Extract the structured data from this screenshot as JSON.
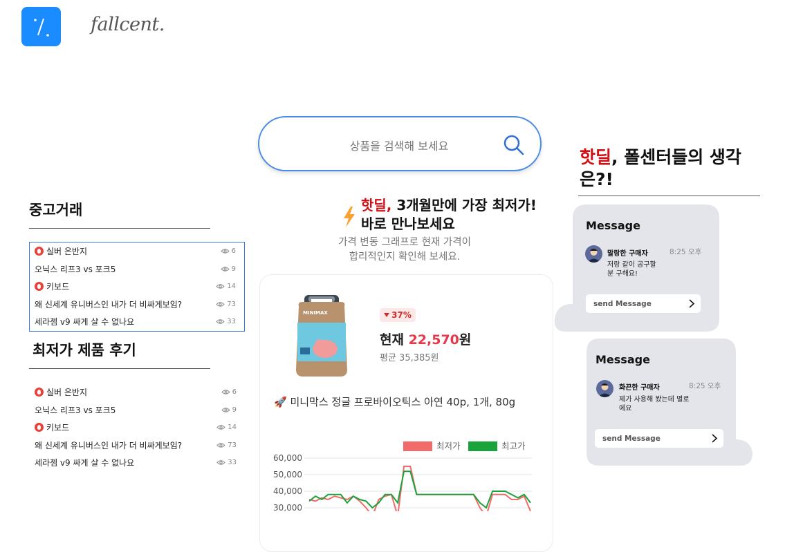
{
  "brand": {
    "name": "fallcent."
  },
  "search": {
    "placeholder": "상품을 검색해 보세요"
  },
  "used_trade": {
    "title": "중고거래",
    "items": [
      {
        "label": "실버 은반지",
        "hot": true,
        "views": "6"
      },
      {
        "label": "오닉스 리프3 vs 포크5",
        "hot": false,
        "views": "9"
      },
      {
        "label": "키보드",
        "hot": true,
        "views": "14"
      },
      {
        "label": "왜 신세계 유니버스인 내가 더 비싸게보임?",
        "hot": false,
        "views": "73"
      },
      {
        "label": "세라젬 v9 싸게 살 수 없나요",
        "hot": false,
        "views": "33"
      }
    ]
  },
  "reviews": {
    "title": "최저가 제품 후기",
    "items": [
      {
        "label": "실버 은반지",
        "hot": true,
        "views": "6"
      },
      {
        "label": "오닉스 리프3 vs 포크5",
        "hot": false,
        "views": "9"
      },
      {
        "label": "키보드",
        "hot": true,
        "views": "14"
      },
      {
        "label": "왜 신세계 유니버스인 내가 더 비싸게보임?",
        "hot": false,
        "views": "73"
      },
      {
        "label": "세라젬 v9 싸게 살 수 없나요",
        "hot": false,
        "views": "33"
      }
    ]
  },
  "deal": {
    "highlight": "핫딜,",
    "headline_1": " 3개월만에 가장 최저가!",
    "headline_2": "바로 만나보세요",
    "sub_1": "가격 변동 그래프로 현재 가격이",
    "sub_2": "합리적인지 확인해 보세요.",
    "discount": "37%",
    "current_label": "현재 ",
    "current_price": "22,570",
    "currency": "원",
    "average": "평균 35,385원",
    "product_name": "🚀 미니막스 정글 프로바이오틱스 아연 40p, 1개, 80g"
  },
  "community": {
    "highlight": "핫딜",
    "title_rest": ", 폴센터들의 생각은?!"
  },
  "messages": [
    {
      "title": "Message",
      "user": "말랑한 구매자",
      "time": "8:25 오후",
      "text": "저랑 같이 공구할 분 구해요!",
      "send": "send Message"
    },
    {
      "title": "Message",
      "user": "화끈한 구매자",
      "time": "8:25 오후",
      "text": "제가 사용해 봤는데 별로에요",
      "send": "send Message"
    }
  ],
  "colors": {
    "accent": "#1a8cff",
    "deal_red": "#d10f14",
    "low_series": "#f26b6b",
    "high_series": "#1aa33a"
  },
  "chart_data": {
    "type": "line",
    "legend": [
      "최저가",
      "최고가"
    ],
    "yticks": [
      "60,000",
      "50,000",
      "40,000",
      "30,000"
    ],
    "ylim": [
      25000,
      65000
    ],
    "series": [
      {
        "name": "최저가",
        "values": [
          35000,
          34000,
          36000,
          35000,
          37000,
          36000,
          35000,
          37000,
          34000,
          30000,
          25000,
          35000,
          37000,
          38000,
          25000,
          55000,
          55000,
          38000,
          38000,
          38000,
          38000,
          38000,
          38000,
          38000,
          38000,
          38000,
          38000,
          30000,
          25000,
          38000,
          38000,
          38000,
          35000,
          35000,
          37000,
          28000
        ]
      },
      {
        "name": "최고가",
        "values": [
          34000,
          37000,
          35000,
          38000,
          38000,
          38000,
          33000,
          37000,
          35000,
          34000,
          30000,
          33000,
          38000,
          38000,
          33000,
          52000,
          52000,
          38000,
          38000,
          38000,
          38000,
          38000,
          38000,
          38000,
          38000,
          38000,
          38000,
          33000,
          30000,
          40000,
          40000,
          40000,
          38000,
          36000,
          38000,
          33000
        ]
      }
    ]
  }
}
